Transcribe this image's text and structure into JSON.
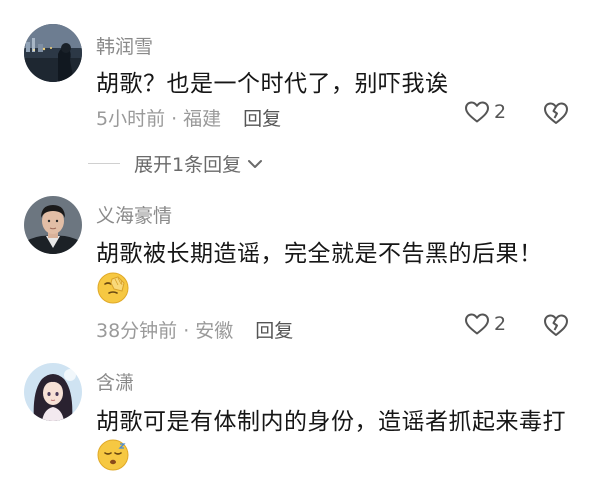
{
  "comments": [
    {
      "username": "韩润雪",
      "text": "胡歌？也是一个时代了，别吓我诶",
      "time": "5小时前",
      "location": "福建",
      "reply_label": "回复",
      "likes": "2",
      "avatar_icon": "night-city-photo"
    },
    {
      "username": "义海豪情",
      "text": "胡歌被长期造谣，完全就是不告黑的后果！",
      "emoji": "facepalm-emoji",
      "time": "38分钟前",
      "location": "安徽",
      "reply_label": "回复",
      "likes": "2",
      "avatar_icon": "man-portrait"
    },
    {
      "username": "含潇",
      "text": "胡歌可是有体制内的身份，造谣者抓起来毒打",
      "emoji": "sleepy-emoji",
      "avatar_icon": "anime-girl-portrait"
    }
  ],
  "expand_replies_label": "展开1条回复",
  "meta_separator": "·",
  "colors": {
    "username": "#8a8a8a",
    "text": "#161616",
    "meta": "#9a9a9a"
  }
}
